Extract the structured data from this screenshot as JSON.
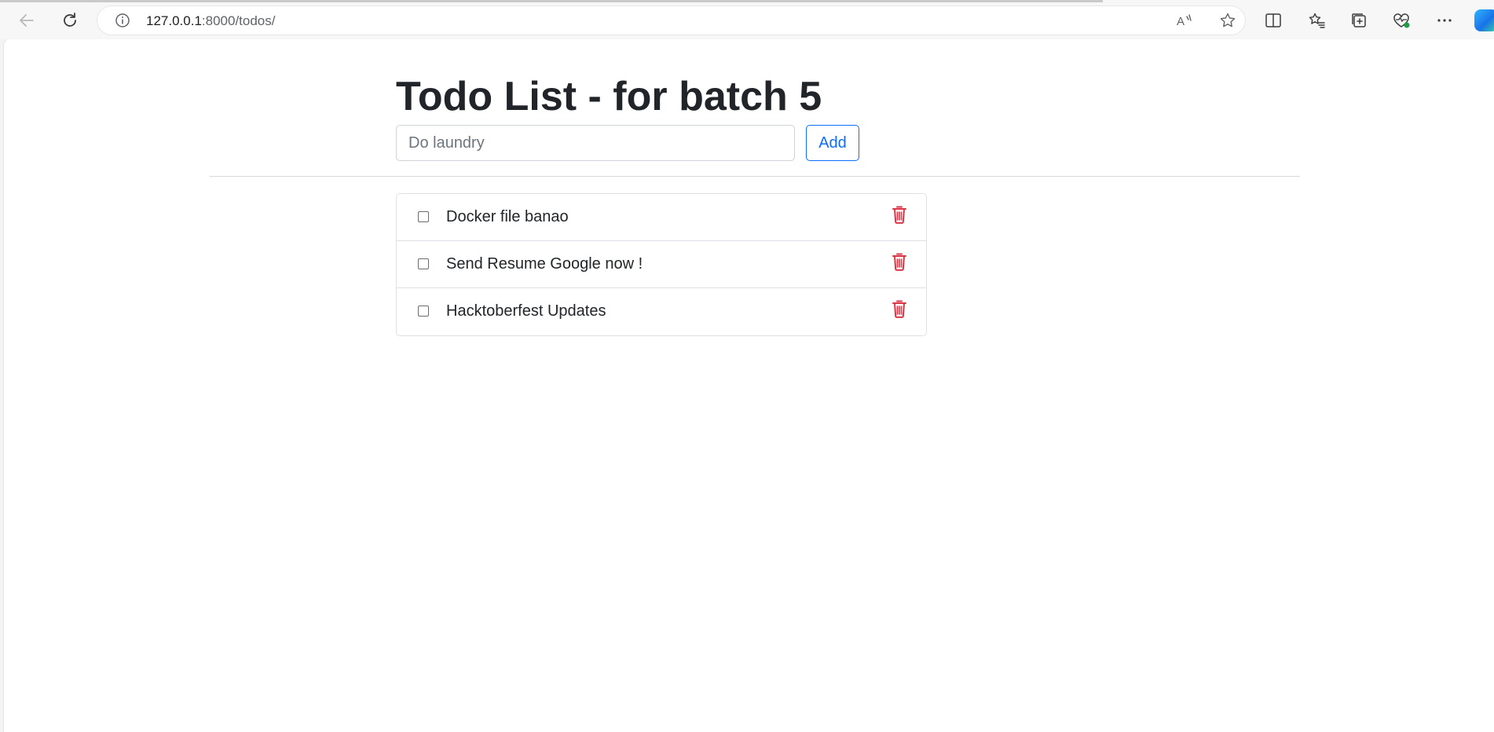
{
  "browser": {
    "url_host": "127.0.0.1",
    "url_path": ":8000/todos/",
    "accent": "#0d6efd"
  },
  "page": {
    "title": "Todo List - for batch 5",
    "input_placeholder": "Do laundry",
    "input_value": "",
    "add_label": "Add"
  },
  "todos": [
    {
      "text": "Docker file banao",
      "checked": false
    },
    {
      "text": "Send Resume Google now !",
      "checked": false
    },
    {
      "text": "Hacktoberfest Updates",
      "checked": false
    }
  ],
  "colors": {
    "delete": "#dc3545",
    "primary": "#0d6efd",
    "text": "#212529"
  }
}
